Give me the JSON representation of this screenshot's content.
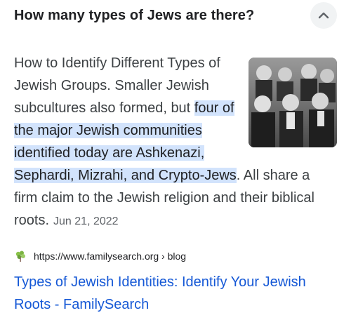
{
  "question": {
    "text": "How many types of Jews are there?",
    "toggle_icon": "chevron-up-icon"
  },
  "answer": {
    "intro": "How to Identify Different Types of Jewish Groups. Smaller Jewish subcultures also formed, but ",
    "highlight": "four of the major Jewish communities identified today are Ashkenazi, Sephardi, Mizrahi, and Crypto-Jews",
    "outro": ". All share a firm claim to the Jewish religion and their biblical roots.",
    "date": "Jun 21, 2022",
    "image": "black-and-white-group-photo"
  },
  "source": {
    "favicon": "familysearch-tree-icon",
    "url": "https://www.familysearch.org › blog"
  },
  "result": {
    "title": "Types of Jewish Identities: Identify Your Jewish Roots - FamilySearch"
  },
  "colors": {
    "highlight": "#d2e3fc",
    "link": "#1558d6",
    "date": "#5f6368",
    "button_bg": "#f1f3f4"
  }
}
